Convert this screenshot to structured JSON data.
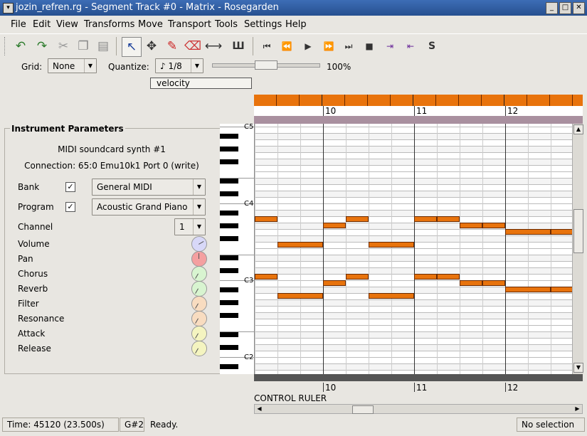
{
  "window": {
    "title": "jozin_refren.rg - Segment Track #0 - Matrix - Rosegarden"
  },
  "menu": [
    "File",
    "Edit",
    "View",
    "Transforms",
    "Move",
    "Transport",
    "Tools",
    "Settings",
    "Help"
  ],
  "toolbar": {
    "icons": [
      "undo-icon",
      "redo-icon",
      "cut-icon",
      "copy-icon",
      "paste-icon",
      "select-icon",
      "move-icon",
      "draw-icon",
      "erase-icon",
      "resize-icon",
      "split-icon",
      "rewind-start-icon",
      "rewind-icon",
      "play-icon",
      "fast-forward-icon",
      "forward-end-icon",
      "stop-icon",
      "loop-start-icon",
      "loop-end-icon",
      "solo-icon"
    ],
    "solo_label": "S"
  },
  "gridbar": {
    "grid_label": "Grid:",
    "grid_value": "None",
    "quantize_label": "Quantize:",
    "quantize_value": "♪ 1/8",
    "zoom": "100%"
  },
  "velocity": "velocity",
  "instrument": {
    "heading": "Instrument Parameters",
    "device": "MIDI soundcard synth #1",
    "connection": "Connection: 65:0 Emu10k1 Port 0 (write)",
    "bank_label": "Bank",
    "bank_value": "General MIDI",
    "program_label": "Program",
    "program_value": "Acoustic Grand Piano",
    "channel_label": "Channel",
    "channel_value": "1",
    "knobs": [
      {
        "label": "Volume",
        "color": "#d8d8f8"
      },
      {
        "label": "Pan",
        "color": "#f4a0a0"
      },
      {
        "label": "Chorus",
        "color": "#d8f4d0"
      },
      {
        "label": "Reverb",
        "color": "#d8f4d0"
      },
      {
        "label": "Filter",
        "color": "#f8dcc0"
      },
      {
        "label": "Resonance",
        "color": "#f8dcc0"
      },
      {
        "label": "Attack",
        "color": "#f4f4c0"
      },
      {
        "label": "Release",
        "color": "#f4f4c0"
      }
    ]
  },
  "piano": {
    "octaves": [
      "C5",
      "C4",
      "C3",
      "C2"
    ]
  },
  "rulers": {
    "bars": [
      "10",
      "11",
      "12"
    ]
  },
  "control_ruler": "CONTROL RULER",
  "status": {
    "time": "Time: 45120 (23.500s)",
    "pitch": "G#2",
    "message": "Ready.",
    "selection": "No selection"
  },
  "colors": {
    "accent": "#e8730c",
    "titlebar": "#2f5ea3",
    "ruler_purple": "#a9909f"
  }
}
